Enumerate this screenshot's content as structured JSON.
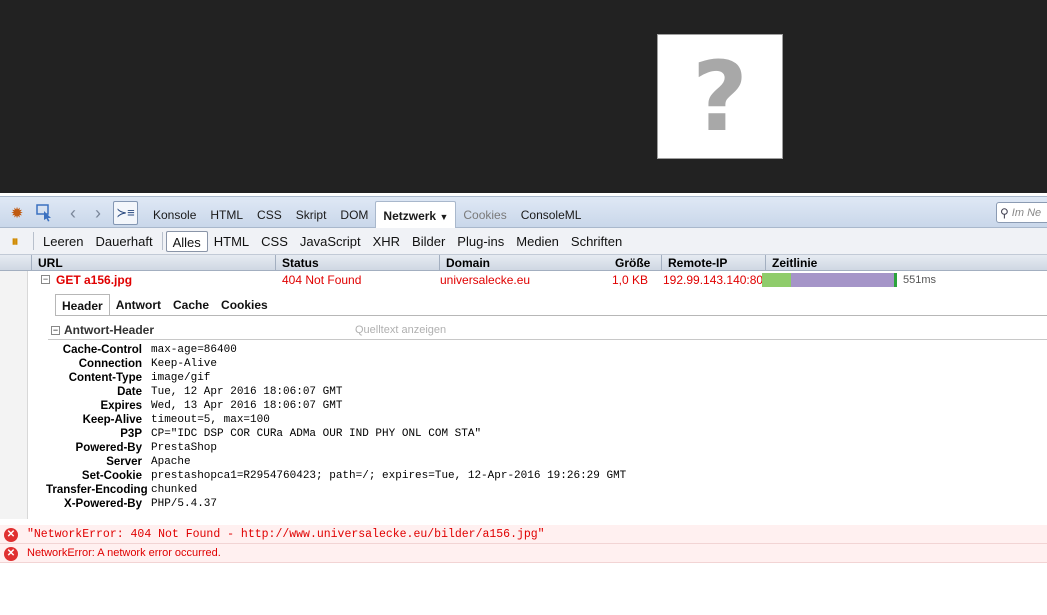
{
  "viewport": {
    "placeholder_glyph": "?"
  },
  "toolbar": {
    "icons": [
      "firebug-icon",
      "inspect-icon",
      "back-icon",
      "forward-icon",
      "command-line-icon"
    ],
    "tabs": [
      {
        "label": "Konsole",
        "state": "normal"
      },
      {
        "label": "HTML",
        "state": "normal"
      },
      {
        "label": "CSS",
        "state": "normal"
      },
      {
        "label": "Skript",
        "state": "normal"
      },
      {
        "label": "DOM",
        "state": "normal"
      },
      {
        "label": "Netzwerk",
        "state": "active"
      },
      {
        "label": "Cookies",
        "state": "disabled"
      },
      {
        "label": "ConsoleML",
        "state": "normal"
      }
    ],
    "search_placeholder": "Im Ne"
  },
  "net_toolbar": {
    "clear": "Leeren",
    "persist": "Dauerhaft",
    "filters": [
      "Alles",
      "HTML",
      "CSS",
      "JavaScript",
      "XHR",
      "Bilder",
      "Plug-ins",
      "Medien",
      "Schriften"
    ],
    "active_filter": "Alles"
  },
  "columns": {
    "url": "URL",
    "status": "Status",
    "domain": "Domain",
    "size": "Größe",
    "remote_ip": "Remote-IP",
    "timeline": "Zeitlinie"
  },
  "request": {
    "expander": "−",
    "url": "GET a156.jpg",
    "status": "404 Not Found",
    "domain": "universalecke.eu",
    "size": "1,0 KB",
    "remote_ip": "192.99.143.140:80",
    "time": "551ms",
    "timeline_wait_fraction": 0.22,
    "colors": {
      "error_text": "#e00000",
      "wait": "#8fcc6b",
      "receive": "#a595c8"
    }
  },
  "detail_tabs": [
    {
      "label": "Header",
      "active": true
    },
    {
      "label": "Antwort",
      "active": false
    },
    {
      "label": "Cache",
      "active": false
    },
    {
      "label": "Cookies",
      "active": false
    }
  ],
  "response_headers": {
    "expander": "−",
    "title": "Antwort-Header",
    "view_source": "Quelltext anzeigen",
    "rows": [
      {
        "name": "Cache-Control",
        "value": "max-age=86400"
      },
      {
        "name": "Connection",
        "value": "Keep-Alive"
      },
      {
        "name": "Content-Type",
        "value": "image/gif"
      },
      {
        "name": "Date",
        "value": "Tue, 12 Apr 2016 18:06:07 GMT"
      },
      {
        "name": "Expires",
        "value": "Wed, 13 Apr 2016 18:06:07 GMT"
      },
      {
        "name": "Keep-Alive",
        "value": "timeout=5, max=100"
      },
      {
        "name": "P3P",
        "value": "CP=\"IDC DSP COR CURa ADMa OUR IND PHY ONL COM STA\""
      },
      {
        "name": "Powered-By",
        "value": "PrestaShop"
      },
      {
        "name": "Server",
        "value": "Apache"
      },
      {
        "name": "Set-Cookie",
        "value": "prestashopca1=R2954760423; path=/; expires=Tue, 12-Apr-2016 19:26:29 GMT"
      },
      {
        "name": "Transfer-Encoding",
        "value": "chunked"
      },
      {
        "name": "X-Powered-By",
        "value": "PHP/5.4.37"
      }
    ]
  },
  "console_errors": [
    {
      "text": "\"NetworkError: 404 Not Found - http://www.universalecke.eu/bilder/a156.jpg\""
    },
    {
      "text": "NetworkError: A network error occurred."
    }
  ]
}
